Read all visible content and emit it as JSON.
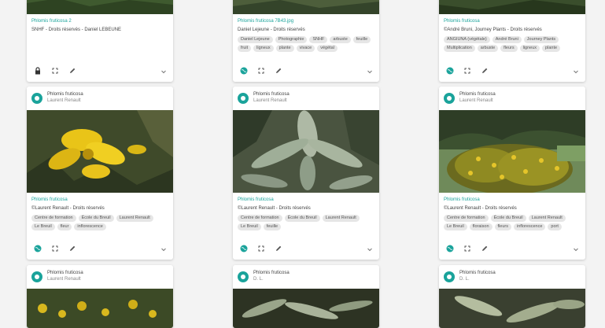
{
  "colors": {
    "accent": "#1aa39b",
    "tag_bg": "#e6e6e6",
    "page_bg": "#f3f3f3"
  },
  "top_cards": [
    {
      "title": "Phlomis fruticosa 2",
      "credit": "SNHF - Droits réservés - Daniel LEBEUNE",
      "tags": [],
      "visibility_icon": "lock-icon"
    },
    {
      "title": "Phlomis fruticosa 7B43.jpg",
      "credit": "Daniel Lejeune - Droits réservés",
      "tags": [
        "Daniel Lejeune",
        "Photographie",
        "SNHF",
        "arbuste",
        "feuille",
        "fruit",
        "ligneux",
        "plante",
        "vivace",
        "végétal"
      ],
      "visibility_icon": "globe-icon"
    },
    {
      "title": "Phlomis fruticosa",
      "credit": "©André Bruni, Journey Plants - Droits réservés",
      "tags": [
        "ANGIUNA (végétale)",
        "André Bruni",
        "Journey Plants",
        "Multiplication",
        "arbuste",
        "fleurs",
        "ligneux",
        "plante"
      ],
      "visibility_icon": "globe-icon"
    }
  ],
  "mid_cards": [
    {
      "species": "Phlomis fruticosa",
      "author": "Laurent Renault",
      "title": "Phlomis fruticosa",
      "credit": "©Laurent Renault - Droits réservés",
      "tags": [
        "Centre de formation",
        "École du Breuil",
        "Laurent Renault",
        "Le Breuil",
        "fleur",
        "inflorescence"
      ],
      "photo": "flower"
    },
    {
      "species": "Phlomis fruticosa",
      "author": "Laurent Renault",
      "title": "Phlomis fruticosa",
      "credit": "©Laurent Renault - Droits réservés",
      "tags": [
        "Centre de formation",
        "École du Breuil",
        "Laurent Renault",
        "Le Breuil",
        "feuille"
      ],
      "photo": "leaves"
    },
    {
      "species": "Phlomis fruticosa",
      "author": "Laurent Renault",
      "title": "Phlomis fruticosa",
      "credit": "©Laurent Renault - Droits réservés",
      "tags": [
        "Centre de formation",
        "École du Breuil",
        "Laurent Renault",
        "Le Breuil",
        "floraison",
        "fleurs",
        "inflorescence",
        "port"
      ],
      "photo": "shrub"
    }
  ],
  "bottom_cards": [
    {
      "species": "Phlomis fruticosa",
      "author": "Laurent Renault"
    },
    {
      "species": "Phlomis fruticosa",
      "author": "D. L."
    },
    {
      "species": "Phlomis fruticosa",
      "author": "D. L."
    }
  ]
}
